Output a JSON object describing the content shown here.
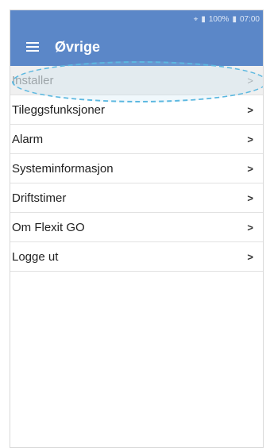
{
  "status_bar": {
    "signal": " .|",
    "battery_text": "100%",
    "time": "07:00"
  },
  "app_bar": {
    "title": "Øvrige"
  },
  "menu": {
    "items": [
      {
        "label": "Installer",
        "chevron": ">"
      },
      {
        "label": "Tileggsfunksjoner",
        "chevron": ">"
      },
      {
        "label": "Alarm",
        "chevron": ">"
      },
      {
        "label": "Systeminformasjon",
        "chevron": ">"
      },
      {
        "label": "Driftstimer",
        "chevron": ">"
      },
      {
        "label": "Om Flexit GO",
        "chevron": ">"
      },
      {
        "label": "Logge ut",
        "chevron": ">"
      }
    ]
  },
  "colors": {
    "app_bar": "#5b87c8",
    "callout": "#5cb8e0"
  },
  "icons": {
    "menu": "hamburger-icon",
    "battery": "battery-icon",
    "wifi": "wifi-icon",
    "chevron": "chevron-right-icon"
  }
}
